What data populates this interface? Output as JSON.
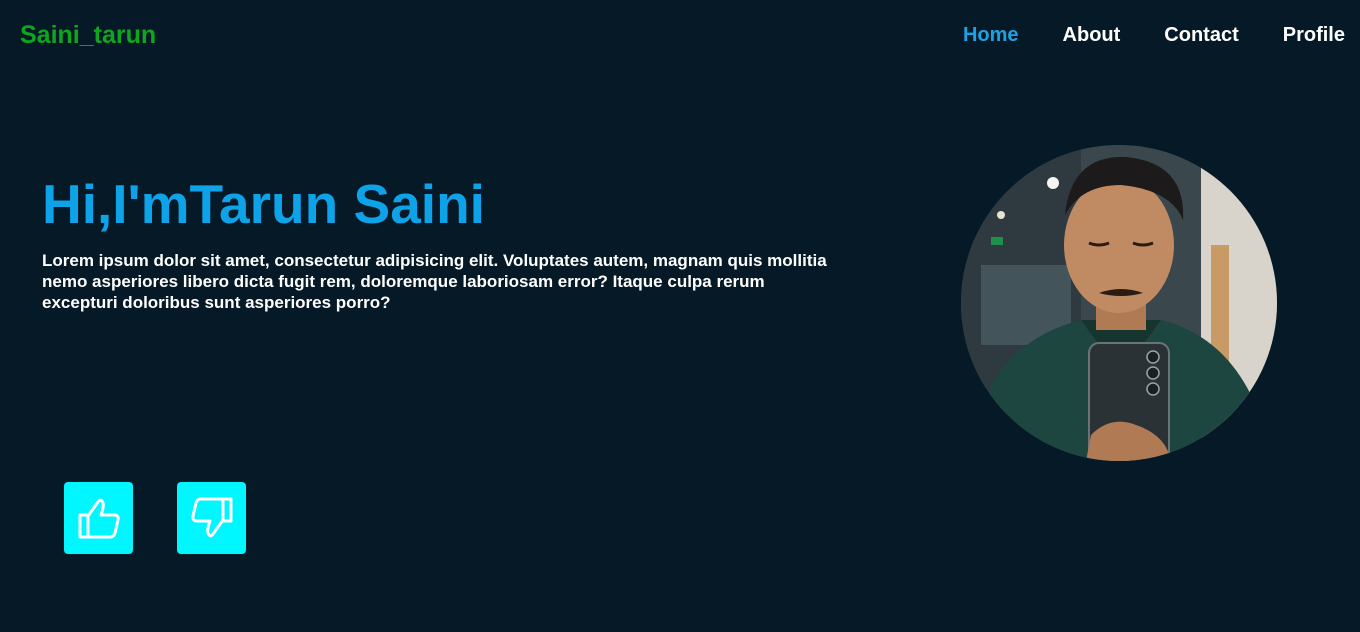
{
  "header": {
    "brand": "Saini_tarun",
    "nav": [
      {
        "label": "Home",
        "active": true
      },
      {
        "label": "About",
        "active": false
      },
      {
        "label": "Contact",
        "active": false
      },
      {
        "label": "Profile",
        "active": false
      }
    ]
  },
  "hero": {
    "title": "Hi,I'mTarun Saini",
    "text": "Lorem ipsum dolor sit amet, consectetur adipisicing elit. Voluptates autem, magnam quis mollitia nemo asperiores libero dicta fugit rem, doloremque laboriosam error? Itaque culpa rerum excepturi doloribus sunt asperiores porro?"
  },
  "profile_photo": {
    "icon": "profile-photo"
  },
  "actions": {
    "like_icon": "thumbs-up-icon",
    "dislike_icon": "thumbs-down-icon",
    "button_color": "#00f7ff"
  },
  "colors": {
    "background": "#061927",
    "brand": "#0ea51f",
    "accent": "#0ea2e8",
    "nav_active": "#1aa3e6",
    "text": "#ffffff"
  }
}
